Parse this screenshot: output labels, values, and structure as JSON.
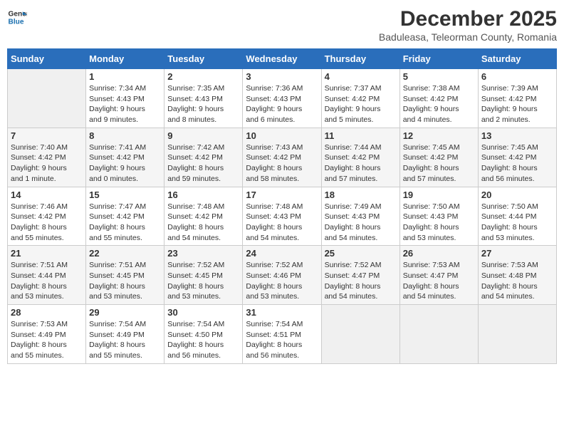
{
  "header": {
    "logo_line1": "General",
    "logo_line2": "Blue",
    "month_title": "December 2025",
    "subtitle": "Baduleasa, Teleorman County, Romania"
  },
  "weekdays": [
    "Sunday",
    "Monday",
    "Tuesday",
    "Wednesday",
    "Thursday",
    "Friday",
    "Saturday"
  ],
  "weeks": [
    [
      {
        "day": "",
        "info": ""
      },
      {
        "day": "1",
        "info": "Sunrise: 7:34 AM\nSunset: 4:43 PM\nDaylight: 9 hours\nand 9 minutes."
      },
      {
        "day": "2",
        "info": "Sunrise: 7:35 AM\nSunset: 4:43 PM\nDaylight: 9 hours\nand 8 minutes."
      },
      {
        "day": "3",
        "info": "Sunrise: 7:36 AM\nSunset: 4:43 PM\nDaylight: 9 hours\nand 6 minutes."
      },
      {
        "day": "4",
        "info": "Sunrise: 7:37 AM\nSunset: 4:42 PM\nDaylight: 9 hours\nand 5 minutes."
      },
      {
        "day": "5",
        "info": "Sunrise: 7:38 AM\nSunset: 4:42 PM\nDaylight: 9 hours\nand 4 minutes."
      },
      {
        "day": "6",
        "info": "Sunrise: 7:39 AM\nSunset: 4:42 PM\nDaylight: 9 hours\nand 2 minutes."
      }
    ],
    [
      {
        "day": "7",
        "info": "Sunrise: 7:40 AM\nSunset: 4:42 PM\nDaylight: 9 hours\nand 1 minute."
      },
      {
        "day": "8",
        "info": "Sunrise: 7:41 AM\nSunset: 4:42 PM\nDaylight: 9 hours\nand 0 minutes."
      },
      {
        "day": "9",
        "info": "Sunrise: 7:42 AM\nSunset: 4:42 PM\nDaylight: 8 hours\nand 59 minutes."
      },
      {
        "day": "10",
        "info": "Sunrise: 7:43 AM\nSunset: 4:42 PM\nDaylight: 8 hours\nand 58 minutes."
      },
      {
        "day": "11",
        "info": "Sunrise: 7:44 AM\nSunset: 4:42 PM\nDaylight: 8 hours\nand 57 minutes."
      },
      {
        "day": "12",
        "info": "Sunrise: 7:45 AM\nSunset: 4:42 PM\nDaylight: 8 hours\nand 57 minutes."
      },
      {
        "day": "13",
        "info": "Sunrise: 7:45 AM\nSunset: 4:42 PM\nDaylight: 8 hours\nand 56 minutes."
      }
    ],
    [
      {
        "day": "14",
        "info": "Sunrise: 7:46 AM\nSunset: 4:42 PM\nDaylight: 8 hours\nand 55 minutes."
      },
      {
        "day": "15",
        "info": "Sunrise: 7:47 AM\nSunset: 4:42 PM\nDaylight: 8 hours\nand 55 minutes."
      },
      {
        "day": "16",
        "info": "Sunrise: 7:48 AM\nSunset: 4:42 PM\nDaylight: 8 hours\nand 54 minutes."
      },
      {
        "day": "17",
        "info": "Sunrise: 7:48 AM\nSunset: 4:43 PM\nDaylight: 8 hours\nand 54 minutes."
      },
      {
        "day": "18",
        "info": "Sunrise: 7:49 AM\nSunset: 4:43 PM\nDaylight: 8 hours\nand 54 minutes."
      },
      {
        "day": "19",
        "info": "Sunrise: 7:50 AM\nSunset: 4:43 PM\nDaylight: 8 hours\nand 53 minutes."
      },
      {
        "day": "20",
        "info": "Sunrise: 7:50 AM\nSunset: 4:44 PM\nDaylight: 8 hours\nand 53 minutes."
      }
    ],
    [
      {
        "day": "21",
        "info": "Sunrise: 7:51 AM\nSunset: 4:44 PM\nDaylight: 8 hours\nand 53 minutes."
      },
      {
        "day": "22",
        "info": "Sunrise: 7:51 AM\nSunset: 4:45 PM\nDaylight: 8 hours\nand 53 minutes."
      },
      {
        "day": "23",
        "info": "Sunrise: 7:52 AM\nSunset: 4:45 PM\nDaylight: 8 hours\nand 53 minutes."
      },
      {
        "day": "24",
        "info": "Sunrise: 7:52 AM\nSunset: 4:46 PM\nDaylight: 8 hours\nand 53 minutes."
      },
      {
        "day": "25",
        "info": "Sunrise: 7:52 AM\nSunset: 4:47 PM\nDaylight: 8 hours\nand 54 minutes."
      },
      {
        "day": "26",
        "info": "Sunrise: 7:53 AM\nSunset: 4:47 PM\nDaylight: 8 hours\nand 54 minutes."
      },
      {
        "day": "27",
        "info": "Sunrise: 7:53 AM\nSunset: 4:48 PM\nDaylight: 8 hours\nand 54 minutes."
      }
    ],
    [
      {
        "day": "28",
        "info": "Sunrise: 7:53 AM\nSunset: 4:49 PM\nDaylight: 8 hours\nand 55 minutes."
      },
      {
        "day": "29",
        "info": "Sunrise: 7:54 AM\nSunset: 4:49 PM\nDaylight: 8 hours\nand 55 minutes."
      },
      {
        "day": "30",
        "info": "Sunrise: 7:54 AM\nSunset: 4:50 PM\nDaylight: 8 hours\nand 56 minutes."
      },
      {
        "day": "31",
        "info": "Sunrise: 7:54 AM\nSunset: 4:51 PM\nDaylight: 8 hours\nand 56 minutes."
      },
      {
        "day": "",
        "info": ""
      },
      {
        "day": "",
        "info": ""
      },
      {
        "day": "",
        "info": ""
      }
    ]
  ]
}
